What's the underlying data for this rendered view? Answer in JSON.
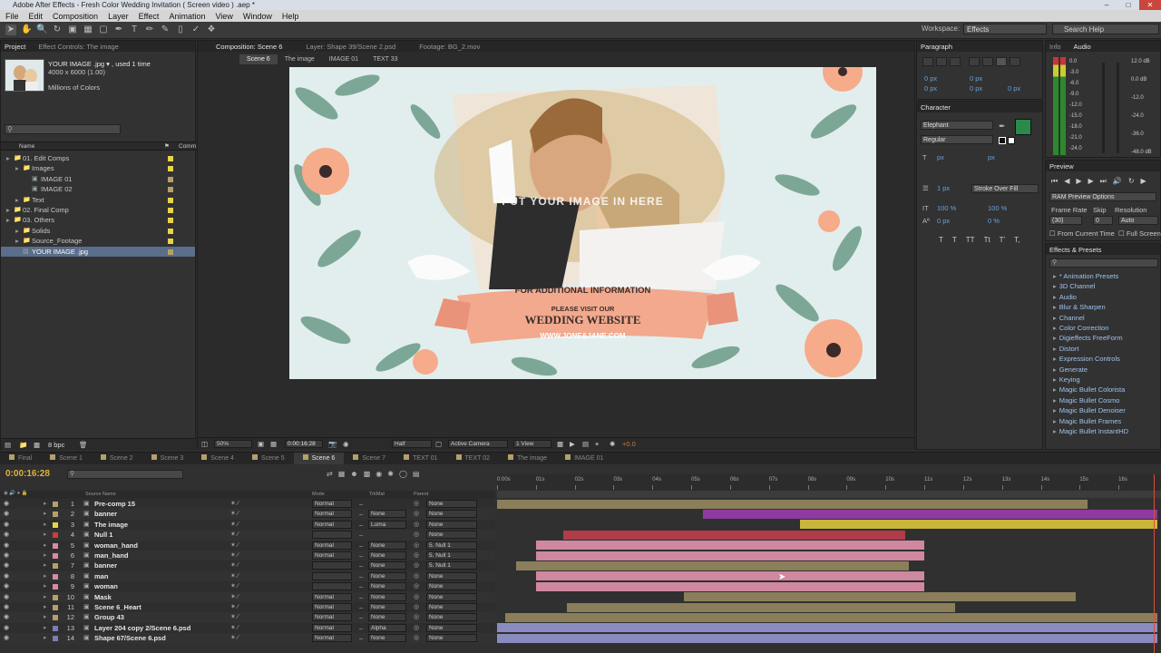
{
  "app": {
    "title": "Adobe After Effects - Fresh Color Wedding Invitation  ( Screen video ) .aep *",
    "menu": [
      "File",
      "Edit",
      "Composition",
      "Layer",
      "Effect",
      "Animation",
      "View",
      "Window",
      "Help"
    ],
    "workspace_label": "Workspace:",
    "workspace_value": "Effects",
    "search_help": "Search Help"
  },
  "project": {
    "tabs": [
      "Project",
      "Effect Controls: The image"
    ],
    "thumb_name": "YOUR IMAGE .jpg ▾ , used 1 time",
    "thumb_dims": "4000 x 6000 (1.00)",
    "thumb_colors": "Millions of Colors",
    "col_name": "Name",
    "col_extra": "Comm",
    "items": [
      {
        "indent": 0,
        "label": "01. Edit Comps",
        "type": "folder",
        "color": "#e8d34a"
      },
      {
        "indent": 1,
        "label": "Images",
        "type": "folder",
        "color": "#e8d34a"
      },
      {
        "indent": 2,
        "label": "IMAGE 01",
        "type": "comp",
        "color": "#b5a06a"
      },
      {
        "indent": 2,
        "label": "IMAGE 02",
        "type": "comp",
        "color": "#b5a06a"
      },
      {
        "indent": 1,
        "label": "Text",
        "type": "folder",
        "color": "#e8d34a"
      },
      {
        "indent": 0,
        "label": "02. Final Comp",
        "type": "folder",
        "color": "#e8d34a"
      },
      {
        "indent": 0,
        "label": "03. Others",
        "type": "folder",
        "color": "#e8d34a"
      },
      {
        "indent": 1,
        "label": "Solids",
        "type": "folder",
        "color": "#e8d34a"
      },
      {
        "indent": 1,
        "label": "Source_Footage",
        "type": "folder",
        "color": "#e8d34a"
      },
      {
        "indent": 1,
        "label": "YOUR IMAGE .jpg",
        "type": "image",
        "color": "#b5a06a",
        "selected": true
      }
    ],
    "bpc": "8 bpc"
  },
  "viewer": {
    "tabs": [
      "Composition: Scene 6",
      "Layer: Shape 39/Scene 2.psd",
      "Footage: BG_2.mov"
    ],
    "breadcrumbs": [
      "Scene 6",
      "The image",
      "IMAGE 01",
      "TEXT 33"
    ],
    "overlay_put": "PUT YOUR IMAGE IN HERE",
    "overlay_info": "FOR ADDITIONAL INFORMATION",
    "overlay_visit": "PLEASE VISIT OUR",
    "overlay_site": "WEDDING WEBSITE",
    "overlay_url": "WWW.JONE&JANE.COM",
    "zoom": "50%",
    "timecode": "0:00:16:28",
    "resolution": "Half",
    "camera": "Active Camera",
    "view": "1 View",
    "exposure": "+0.0"
  },
  "paragraph": {
    "tab": "Paragraph",
    "fields": [
      "0 px",
      "0 px",
      "0 px",
      "0 px",
      "0 px"
    ]
  },
  "character": {
    "tab": "Character",
    "font": "Elephant",
    "style": "Regular",
    "size": "px",
    "leading": "px",
    "stroke": "1 px",
    "stroke_mode": "Stroke Over Fill",
    "vscale": "100 %",
    "hscale": "100 %",
    "baseline": "0 px",
    "tsume": "0 %",
    "styles": [
      "T",
      "T",
      "TT",
      "Tt",
      "T'",
      "T,"
    ],
    "fill_color": "#2a8a4a"
  },
  "audio": {
    "tabs": [
      "Info",
      "Audio"
    ],
    "left_scale": [
      "0.0",
      "-3.0",
      "-6.0",
      "-9.0",
      "-12.0",
      "-15.0",
      "-18.0",
      "-21.0",
      "-24.0"
    ],
    "right_scale": [
      "12.0 dB",
      "0.0 dB",
      "-12.0",
      "-24.0",
      "-36.0",
      "-48.0 dB"
    ]
  },
  "preview": {
    "tab": "Preview",
    "ram_options": "RAM Preview Options",
    "frame_rate_label": "Frame Rate",
    "skip_label": "Skip",
    "resolution_label": "Resolution",
    "frame_rate": "(30)",
    "skip": "0",
    "resolution": "Auto",
    "from_current": "From Current Time",
    "full_screen": "Full Screen"
  },
  "effects": {
    "tab": "Effects & Presets",
    "items": [
      "* Animation Presets",
      "3D Channel",
      "Audio",
      "Blur & Sharpen",
      "Channel",
      "Color Correction",
      "Digieffects FreeForm",
      "Distort",
      "Expression Controls",
      "Generate",
      "Keying",
      "Magic Bullet Colorista",
      "Magic Bullet Cosmo",
      "Magic Bullet Denoiser",
      "Magic Bullet Frames",
      "Magic Bullet InstantHD"
    ]
  },
  "timeline": {
    "tabs": [
      "Final",
      "Scene 1",
      "Scene 2",
      "Scene 3",
      "Scene 4",
      "Scene 5",
      "Scene 6",
      "Scene 7",
      "TEXT 01",
      "TEXT 02",
      "The image",
      "IMAGE 01"
    ],
    "active_tab": "Scene 6",
    "timecode": "0:00:16:28",
    "ruler": [
      "0:00s",
      "01s",
      "02s",
      "03s",
      "04s",
      "05s",
      "06s",
      "07s",
      "08s",
      "09s",
      "10s",
      "11s",
      "12s",
      "13s",
      "14s",
      "15s",
      "16s"
    ],
    "col_source": "Source Name",
    "col_mode": "Mode",
    "col_trkmat": "TrkMat",
    "col_parent": "Parent",
    "layers": [
      {
        "num": "1",
        "name": "Pre-comp 15",
        "label": "#b5a06a",
        "mode": "Normal",
        "trk": "",
        "parent": "None",
        "bar_color": "#8a7f5a",
        "start": 0.0,
        "end": 15.2
      },
      {
        "num": "2",
        "name": "banner",
        "label": "#b5a06a",
        "mode": "Normal",
        "trk": "None",
        "parent": "None",
        "bar_color": "#8e3aa0",
        "start": 5.3,
        "end": 17.0
      },
      {
        "num": "3",
        "name": "The image",
        "label": "#e8d34a",
        "mode": "Normal",
        "trk": "Luma",
        "parent": "None",
        "bar_color": "#c8b73a",
        "start": 7.8,
        "end": 17.0
      },
      {
        "num": "4",
        "name": "Null 1",
        "label": "#d03a3a",
        "mode": "",
        "trk": "",
        "parent": "None",
        "bar_color": "#b03c4a",
        "start": 1.7,
        "end": 10.5
      },
      {
        "num": "5",
        "name": "woman_hand",
        "label": "#d98aa0",
        "mode": "Normal",
        "trk": "None",
        "parent": "5. Null 1",
        "bar_color": "#cf889f",
        "start": 1.0,
        "end": 11.0
      },
      {
        "num": "6",
        "name": "man_hand",
        "label": "#d98aa0",
        "mode": "Normal",
        "trk": "None",
        "parent": "5. Null 1",
        "bar_color": "#cf889f",
        "start": 1.0,
        "end": 11.0
      },
      {
        "num": "7",
        "name": "banner",
        "label": "#b5a06a",
        "mode": "",
        "trk": "None",
        "parent": "5. Null 1",
        "bar_color": "#8a7f5a",
        "start": 0.5,
        "end": 10.6
      },
      {
        "num": "8",
        "name": "man",
        "label": "#d98aa0",
        "mode": "",
        "trk": "None",
        "parent": "None",
        "bar_color": "#cf889f",
        "start": 1.0,
        "end": 11.0
      },
      {
        "num": "9",
        "name": "woman",
        "label": "#d98aa0",
        "mode": "",
        "trk": "None",
        "parent": "None",
        "bar_color": "#cf889f",
        "start": 1.0,
        "end": 11.0
      },
      {
        "num": "10",
        "name": "Mask",
        "label": "#b5a06a",
        "mode": "Normal",
        "trk": "None",
        "parent": "None",
        "bar_color": "#8a7f5a",
        "start": 4.8,
        "end": 14.9
      },
      {
        "num": "11",
        "name": "Scene 6_Heart",
        "label": "#b5a06a",
        "mode": "Normal",
        "trk": "None",
        "parent": "None",
        "bar_color": "#8a7f5a",
        "start": 1.8,
        "end": 11.8
      },
      {
        "num": "12",
        "name": "Group 43",
        "label": "#b5a06a",
        "mode": "Normal",
        "trk": "None",
        "parent": "None",
        "bar_color": "#8a7f5a",
        "start": 0.2,
        "end": 17.0
      },
      {
        "num": "13",
        "name": "Layer 204 copy 2/Scene 6.psd",
        "label": "#7a7fb5",
        "mode": "Normal",
        "trk": "Alpha",
        "parent": "None",
        "bar_color": "#8a8cc0",
        "start": 0.0,
        "end": 17.0
      },
      {
        "num": "14",
        "name": "Shape 67/Scene 6.psd",
        "label": "#7a7fb5",
        "mode": "Normal",
        "trk": "None",
        "parent": "None",
        "bar_color": "#8a8cc0",
        "start": 0.0,
        "end": 17.0
      }
    ],
    "duration_seconds": 17,
    "playhead_seconds": 16.9
  }
}
